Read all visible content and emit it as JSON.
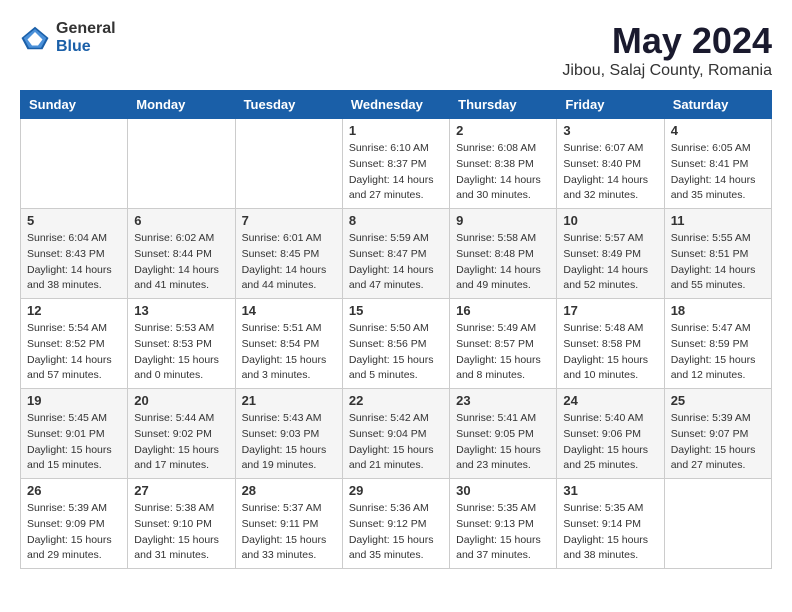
{
  "header": {
    "logo_general": "General",
    "logo_blue": "Blue",
    "title": "May 2024",
    "subtitle": "Jibou, Salaj County, Romania"
  },
  "calendar": {
    "days_of_week": [
      "Sunday",
      "Monday",
      "Tuesday",
      "Wednesday",
      "Thursday",
      "Friday",
      "Saturday"
    ],
    "weeks": [
      [
        {
          "day": "",
          "info": ""
        },
        {
          "day": "",
          "info": ""
        },
        {
          "day": "",
          "info": ""
        },
        {
          "day": "1",
          "info": "Sunrise: 6:10 AM\nSunset: 8:37 PM\nDaylight: 14 hours\nand 27 minutes."
        },
        {
          "day": "2",
          "info": "Sunrise: 6:08 AM\nSunset: 8:38 PM\nDaylight: 14 hours\nand 30 minutes."
        },
        {
          "day": "3",
          "info": "Sunrise: 6:07 AM\nSunset: 8:40 PM\nDaylight: 14 hours\nand 32 minutes."
        },
        {
          "day": "4",
          "info": "Sunrise: 6:05 AM\nSunset: 8:41 PM\nDaylight: 14 hours\nand 35 minutes."
        }
      ],
      [
        {
          "day": "5",
          "info": "Sunrise: 6:04 AM\nSunset: 8:43 PM\nDaylight: 14 hours\nand 38 minutes."
        },
        {
          "day": "6",
          "info": "Sunrise: 6:02 AM\nSunset: 8:44 PM\nDaylight: 14 hours\nand 41 minutes."
        },
        {
          "day": "7",
          "info": "Sunrise: 6:01 AM\nSunset: 8:45 PM\nDaylight: 14 hours\nand 44 minutes."
        },
        {
          "day": "8",
          "info": "Sunrise: 5:59 AM\nSunset: 8:47 PM\nDaylight: 14 hours\nand 47 minutes."
        },
        {
          "day": "9",
          "info": "Sunrise: 5:58 AM\nSunset: 8:48 PM\nDaylight: 14 hours\nand 49 minutes."
        },
        {
          "day": "10",
          "info": "Sunrise: 5:57 AM\nSunset: 8:49 PM\nDaylight: 14 hours\nand 52 minutes."
        },
        {
          "day": "11",
          "info": "Sunrise: 5:55 AM\nSunset: 8:51 PM\nDaylight: 14 hours\nand 55 minutes."
        }
      ],
      [
        {
          "day": "12",
          "info": "Sunrise: 5:54 AM\nSunset: 8:52 PM\nDaylight: 14 hours\nand 57 minutes."
        },
        {
          "day": "13",
          "info": "Sunrise: 5:53 AM\nSunset: 8:53 PM\nDaylight: 15 hours\nand 0 minutes."
        },
        {
          "day": "14",
          "info": "Sunrise: 5:51 AM\nSunset: 8:54 PM\nDaylight: 15 hours\nand 3 minutes."
        },
        {
          "day": "15",
          "info": "Sunrise: 5:50 AM\nSunset: 8:56 PM\nDaylight: 15 hours\nand 5 minutes."
        },
        {
          "day": "16",
          "info": "Sunrise: 5:49 AM\nSunset: 8:57 PM\nDaylight: 15 hours\nand 8 minutes."
        },
        {
          "day": "17",
          "info": "Sunrise: 5:48 AM\nSunset: 8:58 PM\nDaylight: 15 hours\nand 10 minutes."
        },
        {
          "day": "18",
          "info": "Sunrise: 5:47 AM\nSunset: 8:59 PM\nDaylight: 15 hours\nand 12 minutes."
        }
      ],
      [
        {
          "day": "19",
          "info": "Sunrise: 5:45 AM\nSunset: 9:01 PM\nDaylight: 15 hours\nand 15 minutes."
        },
        {
          "day": "20",
          "info": "Sunrise: 5:44 AM\nSunset: 9:02 PM\nDaylight: 15 hours\nand 17 minutes."
        },
        {
          "day": "21",
          "info": "Sunrise: 5:43 AM\nSunset: 9:03 PM\nDaylight: 15 hours\nand 19 minutes."
        },
        {
          "day": "22",
          "info": "Sunrise: 5:42 AM\nSunset: 9:04 PM\nDaylight: 15 hours\nand 21 minutes."
        },
        {
          "day": "23",
          "info": "Sunrise: 5:41 AM\nSunset: 9:05 PM\nDaylight: 15 hours\nand 23 minutes."
        },
        {
          "day": "24",
          "info": "Sunrise: 5:40 AM\nSunset: 9:06 PM\nDaylight: 15 hours\nand 25 minutes."
        },
        {
          "day": "25",
          "info": "Sunrise: 5:39 AM\nSunset: 9:07 PM\nDaylight: 15 hours\nand 27 minutes."
        }
      ],
      [
        {
          "day": "26",
          "info": "Sunrise: 5:39 AM\nSunset: 9:09 PM\nDaylight: 15 hours\nand 29 minutes."
        },
        {
          "day": "27",
          "info": "Sunrise: 5:38 AM\nSunset: 9:10 PM\nDaylight: 15 hours\nand 31 minutes."
        },
        {
          "day": "28",
          "info": "Sunrise: 5:37 AM\nSunset: 9:11 PM\nDaylight: 15 hours\nand 33 minutes."
        },
        {
          "day": "29",
          "info": "Sunrise: 5:36 AM\nSunset: 9:12 PM\nDaylight: 15 hours\nand 35 minutes."
        },
        {
          "day": "30",
          "info": "Sunrise: 5:35 AM\nSunset: 9:13 PM\nDaylight: 15 hours\nand 37 minutes."
        },
        {
          "day": "31",
          "info": "Sunrise: 5:35 AM\nSunset: 9:14 PM\nDaylight: 15 hours\nand 38 minutes."
        },
        {
          "day": "",
          "info": ""
        }
      ]
    ]
  }
}
